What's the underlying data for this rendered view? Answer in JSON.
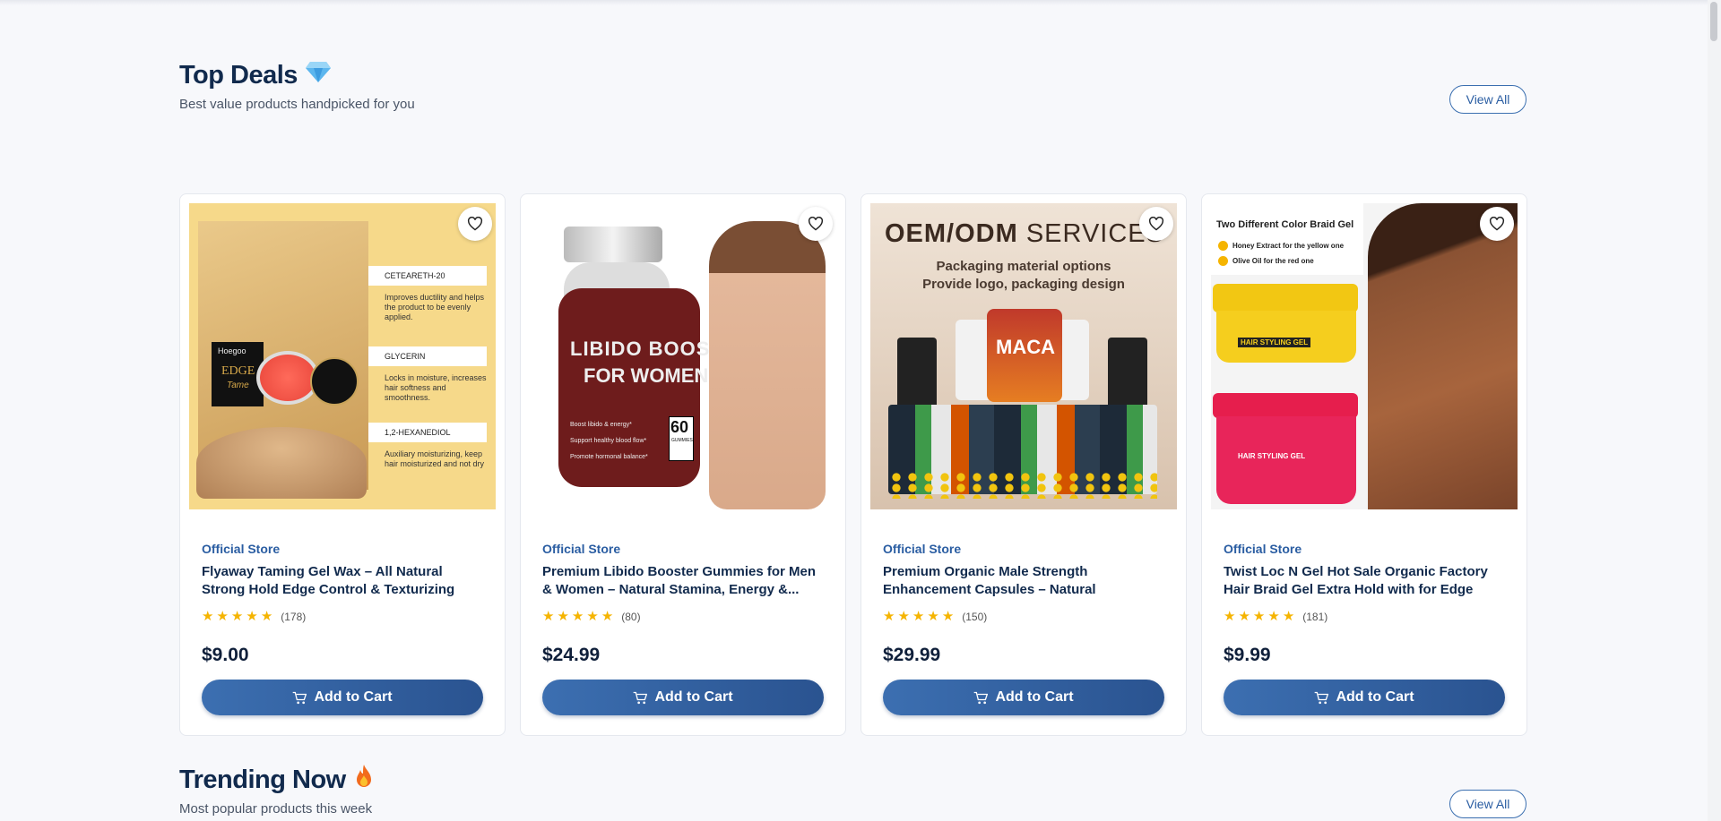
{
  "sections": [
    {
      "title": "Top Deals",
      "subtitle": "Best value products handpicked for you",
      "view_all": "View All"
    },
    {
      "title": "Trending Now",
      "subtitle": "Most popular products this week",
      "view_all": "View All"
    }
  ],
  "products": [
    {
      "store": "Official Store",
      "title": "Flyaway Taming Gel Wax – All Natural Strong Hold Edge Control & Texturizing Styling...",
      "rating": 5,
      "reviews": "(178)",
      "price": "$9.00",
      "cart": "Add to Cart",
      "image": {
        "brand": "Hoegoo",
        "edge": "EDGE",
        "tame": "Tame",
        "ing1": "CETEARETH-20",
        "ing1_desc": "Improves ductility and helps the product to be evenly applied.",
        "ing2": "GLYCERIN",
        "ing2_desc": "Locks in moisture, increases hair softness and smoothness.",
        "ing3": "1,2-HEXANEDIOL",
        "ing3_desc": "Auxiliary moisturizing, keep hair moisturized and not dry"
      }
    },
    {
      "store": "Official Store",
      "title": "Premium Libido Booster Gummies for Men & Women – Natural Stamina, Energy &...",
      "rating": 5,
      "reviews": "(80)",
      "price": "$24.99",
      "cart": "Add to Cart",
      "image": {
        "label1": "LIBIDO BOOSTER",
        "label2": "FOR WOMEN",
        "count": "60",
        "count_label": "GUMMIES",
        "b1": "Boost libido & energy*",
        "b2": "Support healthy blood flow*",
        "b3": "Promote hormonal balance*"
      }
    },
    {
      "store": "Official Store",
      "title": "Premium Organic Male Strength Enhancement Capsules – Natural Stamina,...",
      "rating": 5,
      "reviews": "(150)",
      "price": "$29.99",
      "cart": "Add to Cart",
      "image": {
        "h1a": "OEM/ODM",
        "h1b": " SERVICES",
        "l1": "Packaging material options",
        "l2": "Provide logo, packaging design",
        "maca": "MACA"
      }
    },
    {
      "store": "Official Store",
      "title": "Twist Loc N Gel Hot Sale Organic Factory Hair Braid Gel Extra Hold with for Edge Control...",
      "rating": 5,
      "reviews": "(181)",
      "price": "$9.99",
      "cart": "Add to Cart",
      "image": {
        "h": "Two Different Color Braid Gel",
        "c1": "Honey Extract for the yellow one",
        "c2": "Olive Oil for the red one",
        "jar": "HAIR STYLING GEL"
      }
    }
  ],
  "colors": {
    "accent": "#2a5da2",
    "star": "#f5b400",
    "title": "#112a4d"
  }
}
